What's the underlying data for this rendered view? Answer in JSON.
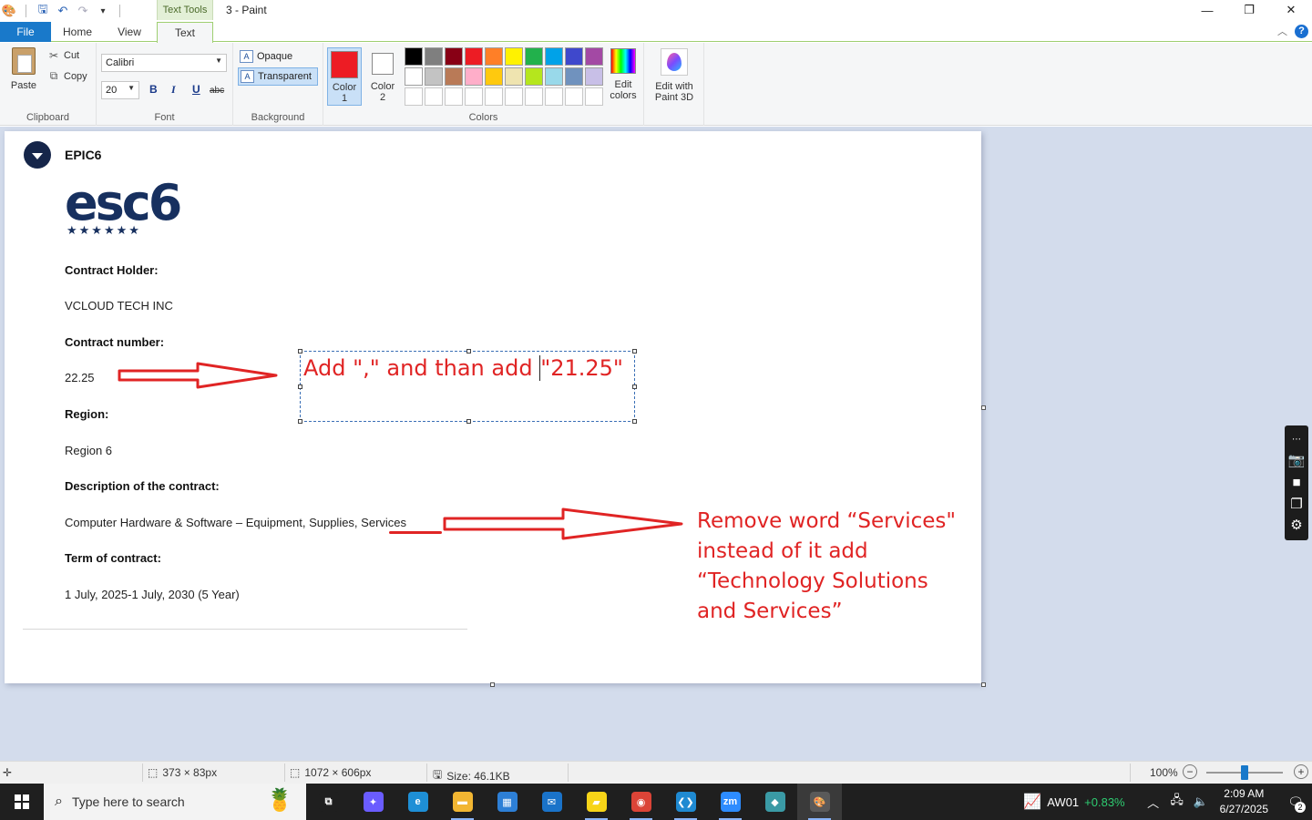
{
  "window": {
    "title": "3 - Paint",
    "context_tab": "Text Tools",
    "minimize_glyph": "—",
    "restore_glyph": "❐",
    "close_glyph": "✕"
  },
  "tabs": {
    "file": "File",
    "home": "Home",
    "view": "View",
    "text": "Text"
  },
  "ribbon": {
    "clipboard": {
      "paste": "Paste",
      "cut": "Cut",
      "copy": "Copy",
      "label": "Clipboard"
    },
    "font": {
      "family": "Calibri",
      "size": "20",
      "bold": "B",
      "italic": "I",
      "underline": "U",
      "strike": "abc",
      "label": "Font"
    },
    "background": {
      "opaque": "Opaque",
      "transparent": "Transparent",
      "label": "Background",
      "selected": "transparent"
    },
    "colors": {
      "color1_label": "Color\n1",
      "color2_label": "Color\n2",
      "color1": "#ed1c24",
      "color2": "#ffffff",
      "edit_colors": "Edit\ncolors",
      "label": "Colors",
      "palette": [
        "#000000",
        "#7f7f7f",
        "#880015",
        "#ed1c24",
        "#ff7f27",
        "#fff200",
        "#22b14c",
        "#00a2e8",
        "#3f48cc",
        "#a349a4",
        "#ffffff",
        "#c3c3c3",
        "#b97a57",
        "#ffaec9",
        "#ffc90e",
        "#efe4b0",
        "#b5e61d",
        "#99d9ea",
        "#7092be",
        "#c8bfe7",
        "#ffffff",
        "#ffffff",
        "#ffffff",
        "#ffffff",
        "#ffffff",
        "#ffffff",
        "#ffffff",
        "#ffffff",
        "#ffffff",
        "#ffffff"
      ]
    },
    "paint3d": "Edit with\nPaint 3D"
  },
  "document": {
    "org_name": "EPIC6",
    "logo_text": "esc6",
    "logo_stars": "★★★★★★",
    "fields": [
      {
        "label": "Contract Holder:",
        "value": "VCLOUD TECH INC"
      },
      {
        "label": "Contract number:",
        "value": "22.25"
      },
      {
        "label": "Region:",
        "value": "Region 6"
      },
      {
        "label": "Description of the contract:",
        "value": "Computer Hardware & Software – Equipment, Supplies, ",
        "value_tail": "Services"
      },
      {
        "label": "Term of contract:",
        "value": "1 July, 2025-1 July, 2030 (5 Year)"
      }
    ]
  },
  "annotations": {
    "textbox_before": "Add \",\" and than add ",
    "textbox_after": "\"21.25\"",
    "note": "Remove word “Services\" instead of it add “Technology Solutions and Services”",
    "color": "#e02424"
  },
  "statusbar": {
    "selection_size": "373 × 83px",
    "canvas_size": "1072 × 606px",
    "file_size": "Size: 46.1KB",
    "zoom": "100%",
    "zoom_out": "−",
    "zoom_in": "+"
  },
  "taskbar": {
    "search_placeholder": "Type here to search",
    "stock_symbol": "AW01",
    "stock_change": "+0.83%",
    "time": "2:09 AM",
    "date": "6/27/2025",
    "notification_count": "2",
    "apps": [
      {
        "name": "task-view",
        "glyph": "⧉",
        "color": "#1f1f1f"
      },
      {
        "name": "copilot",
        "glyph": "✦",
        "color": "#6a5cff"
      },
      {
        "name": "edge",
        "glyph": "e",
        "color": "#1e8fd6"
      },
      {
        "name": "file-explorer",
        "glyph": "▬",
        "color": "#f2b632"
      },
      {
        "name": "store",
        "glyph": "▦",
        "color": "#2d7fd6"
      },
      {
        "name": "mail",
        "glyph": "✉",
        "color": "#1a73c9"
      },
      {
        "name": "sticky-notes",
        "glyph": "▰",
        "color": "#f7d418"
      },
      {
        "name": "chrome",
        "glyph": "◉",
        "color": "#db4437"
      },
      {
        "name": "vscode",
        "glyph": "❮❯",
        "color": "#1f8ad2"
      },
      {
        "name": "zoom",
        "glyph": "zm",
        "color": "#2d8cff"
      },
      {
        "name": "app",
        "glyph": "◆",
        "color": "#3a9aa5"
      },
      {
        "name": "paint",
        "glyph": "🎨",
        "color": "#5a5a5a"
      }
    ]
  }
}
